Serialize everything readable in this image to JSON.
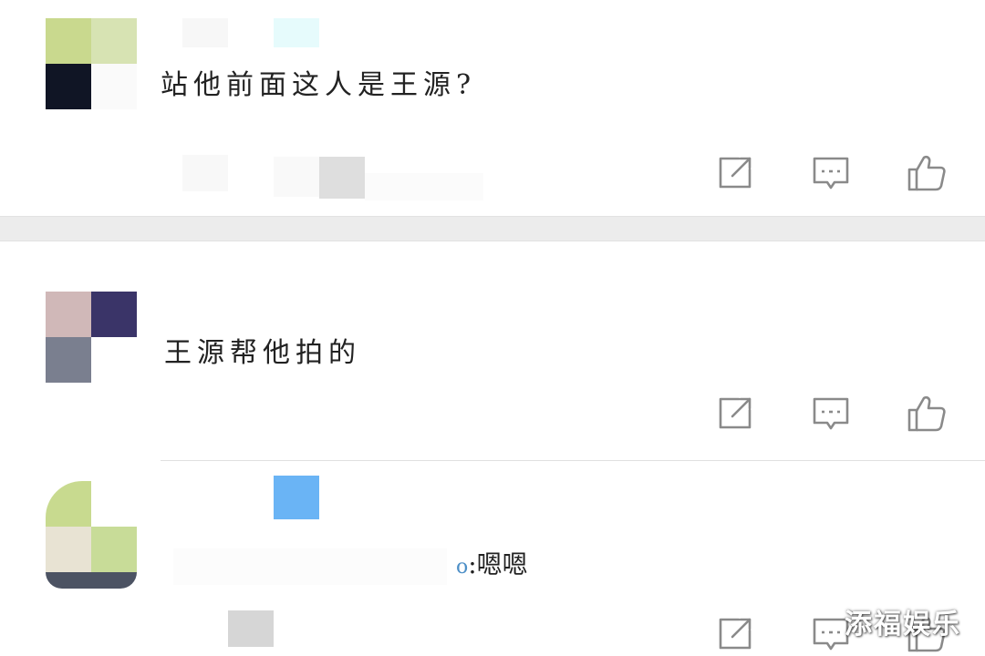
{
  "comments": [
    {
      "text": "站他前面这人是王源?",
      "avatar_colors": [
        "#c9d98e",
        "#d7e3b3",
        "#101525",
        "#fafafa"
      ]
    },
    {
      "text": "王源帮他拍的",
      "avatar_colors": [
        "#d0b8b8",
        "#3a3468",
        "#7a7f8f",
        "#ffffff"
      ]
    },
    {
      "reply_prefix": "o",
      "text": ":嗯嗯",
      "avatar_colors": [
        "#c8da8f",
        "#ffffff",
        "#e8e3d3",
        "#c8dc98"
      ]
    }
  ],
  "actions": {
    "share_icon": "share-icon",
    "comment_icon": "comment-icon",
    "like_icon": "thumbs-up-icon"
  },
  "colors": {
    "icon": "#8a8a8a",
    "separator": "#ececec",
    "reply_accent": "#6ab4f5"
  },
  "watermark": "添福娱乐"
}
